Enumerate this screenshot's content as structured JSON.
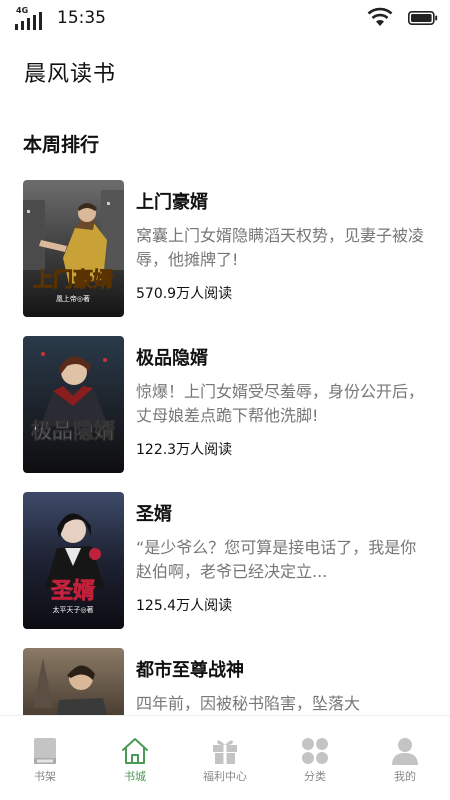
{
  "status_bar": {
    "network": "4G",
    "time": "15:35"
  },
  "app_title": "晨风读书",
  "section_title": "本周排行",
  "books": [
    {
      "title": "上门豪婿",
      "desc": "窝囊上门女婿隐瞒滔天权势，见妻子被凌辱，他摊牌了!",
      "readers": "570.9万人阅读",
      "cover_title": "上门豪婿",
      "cover_author": "凰上帝◎著"
    },
    {
      "title": "极品隐婿",
      "desc": "惊爆！上门女婿受尽羞辱，身份公开后，丈母娘差点跪下帮他洗脚!",
      "readers": "122.3万人阅读",
      "cover_title": "极品隐婿",
      "cover_author": ""
    },
    {
      "title": "圣婿",
      "desc": "“是少爷么？您可算是接电话了，我是你赵伯啊，老爷已经决定立...",
      "readers": "125.4万人阅读",
      "cover_title": "圣婿",
      "cover_author": "太平天子◎著"
    },
    {
      "title": "都市至尊战神",
      "desc": "四年前，因被秘书陷害，坠落大",
      "readers": "",
      "cover_title": "",
      "cover_author": ""
    }
  ],
  "tabs": [
    {
      "label": "书架",
      "icon": "bookshelf-icon",
      "active": false
    },
    {
      "label": "书城",
      "icon": "home-icon",
      "active": true
    },
    {
      "label": "福利中心",
      "icon": "gift-icon",
      "active": false
    },
    {
      "label": "分类",
      "icon": "category-icon",
      "active": false
    },
    {
      "label": "我的",
      "icon": "profile-icon",
      "active": false
    }
  ],
  "colors": {
    "accent": "#4a9a55",
    "tab_inactive": "#888888",
    "icon_inactive": "#c4c4c4"
  }
}
